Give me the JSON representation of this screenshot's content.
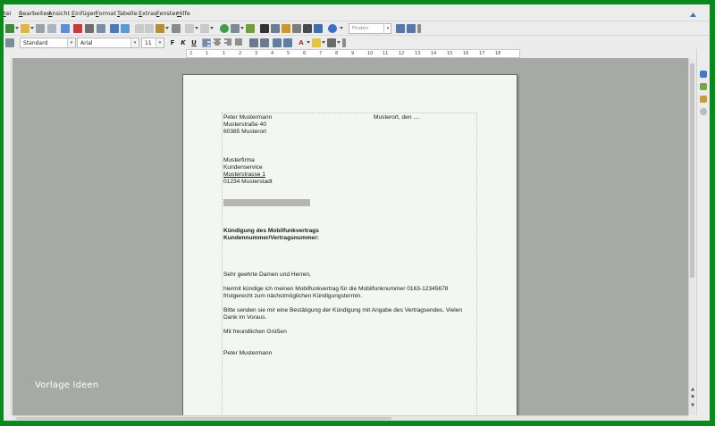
{
  "menu": [
    "tei",
    "Bearbeiten",
    "Ansicht",
    "Einfügen",
    "Format",
    "Tabelle",
    "Extras",
    "Fenster",
    "Hilfe"
  ],
  "toolbar": {
    "find_placeholder": "Finden"
  },
  "formatting": {
    "paragraph_style": "Standard",
    "font_name": "Arial",
    "font_size": "11",
    "bold": "F",
    "italic": "K",
    "underline": "U"
  },
  "ruler": [
    "2",
    "1",
    "1",
    "2",
    "3",
    "4",
    "5",
    "6",
    "7",
    "8",
    "9",
    "10",
    "11",
    "12",
    "13",
    "14",
    "15",
    "16",
    "17",
    "18"
  ],
  "document": {
    "sender_name": "Peter Mustermann",
    "place_date": "Musterort, den ....",
    "sender_street": "Musterstraße 40",
    "sender_city": "60385 Musterort",
    "recipient_company": "Musterfirma",
    "recipient_department": "Kundenservice",
    "recipient_street": "Musterstrasse 1",
    "recipient_city": "01234 Musterstadt",
    "subject_line1": "Kündigung des Mobilfunkvertrags",
    "subject_line2": "Kundennummer/Vertragsnummer:",
    "salutation": "Sehr geehrte Damen und Herren,",
    "body1_line1": "hiermit kündige ich meinen Mobilfunkvertrag für die Mobilfunknummer 0163-12345678",
    "body1_line2": "fristgerecht zum nächstmöglichen Kündigungstermin.",
    "body2_line1": "Bitte senden sie mir eine Bestätigung der Kündigung mit Angabe des Vertragsendes. Vielen",
    "body2_line2": "Dank im Voraus.",
    "closing": "Mit freundlichen Grüßen",
    "signature": "Peter Mustermann"
  },
  "watermark": "Vorlage Ideen",
  "colors": {
    "frame_border": "#0a8a1c",
    "workspace": "#a6aaa4",
    "page": "#f4f6f2"
  }
}
